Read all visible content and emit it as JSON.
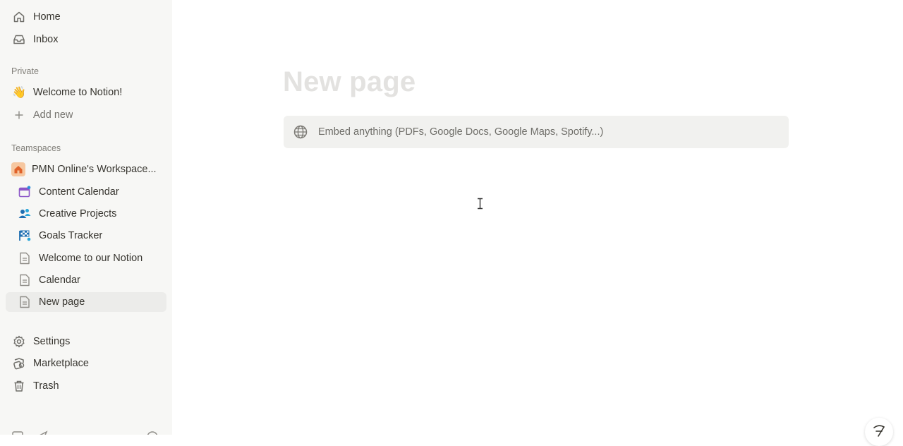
{
  "sidebar": {
    "home": "Home",
    "inbox": "Inbox",
    "private_label": "Private",
    "welcome_emoji": "👋",
    "welcome": "Welcome to Notion!",
    "add_new": "Add new",
    "teamspaces_label": "Teamspaces",
    "workspace": "PMN Online's Workspace...",
    "children": [
      {
        "label": "Content Calendar",
        "icon": "calendar-icon"
      },
      {
        "label": "Creative Projects",
        "icon": "people-icon"
      },
      {
        "label": "Goals Tracker",
        "icon": "flag-icon"
      },
      {
        "label": "Welcome to our Notion",
        "icon": "page-icon"
      },
      {
        "label": "Calendar",
        "icon": "page-icon"
      },
      {
        "label": "New page",
        "icon": "page-icon",
        "selected": true
      }
    ],
    "settings": "Settings",
    "marketplace": "Marketplace",
    "trash": "Trash"
  },
  "main": {
    "title_placeholder": "New page",
    "embed_text": "Embed anything (PDFs, Google Docs, Google Maps, Spotify...)"
  },
  "colors": {
    "sidebar_bg": "#f7f7f5",
    "selected_bg": "#ececea",
    "title_placeholder": "#e3e2e0",
    "embed_bg": "#f1f1ef",
    "workspace_icon_bg": "#f6c7a0"
  }
}
